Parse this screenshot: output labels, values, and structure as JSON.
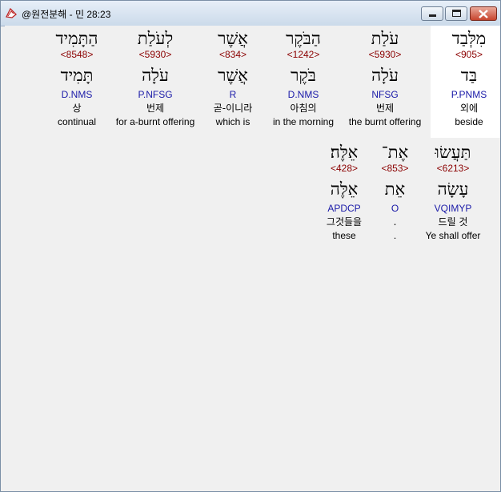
{
  "window": {
    "title": "@원전분해 - 민 28:23"
  },
  "words": [
    {
      "heb": "מִלְּבַד",
      "strong": "<905>",
      "lemma": "בַּד",
      "morph": "P.PNMS",
      "kor": "외에",
      "eng": "beside",
      "selected": true
    },
    {
      "heb": "עֹלַת",
      "strong": "<5930>",
      "lemma": "עֹלָה",
      "morph": "NFSG",
      "kor": "번제",
      "eng": "the burnt offering"
    },
    {
      "heb": "הַבֹּקֶר",
      "strong": "<1242>",
      "lemma": "בֹּקֶר",
      "morph": "D.NMS",
      "kor": "아침의",
      "eng": "in the morning"
    },
    {
      "heb": "אֲשֶׁר",
      "strong": "<834>",
      "lemma": "אֲשֶׁר",
      "morph": "R",
      "kor": "곧-이니라",
      "eng": "which is"
    },
    {
      "heb": "לְעֹלַת",
      "strong": "<5930>",
      "lemma": "עֹלָה",
      "morph": "P.NFSG",
      "kor": "번제",
      "eng": "for a-burnt offering"
    },
    {
      "heb": "הַתָּמִיד",
      "strong": "<8548>",
      "lemma": "תָּמִיד",
      "morph": "D.NMS",
      "kor": "상",
      "eng": "continual"
    },
    {
      "heb": "תַּעֲשׂוּ",
      "strong": "<6213>",
      "lemma": "עָשָׂה",
      "morph": "VQIMYP",
      "kor": "드릴 것",
      "eng": "Ye shall offer"
    },
    {
      "heb": "אֶת־",
      "strong": "<853>",
      "lemma": "אֵת",
      "morph": "O",
      "kor": ".",
      "eng": "."
    },
    {
      "heb": "אֵלֶּה׃",
      "strong": "<428>",
      "lemma": "אֵלֶּה",
      "morph": "APDCP",
      "kor": "그것들을",
      "eng": "these"
    }
  ]
}
